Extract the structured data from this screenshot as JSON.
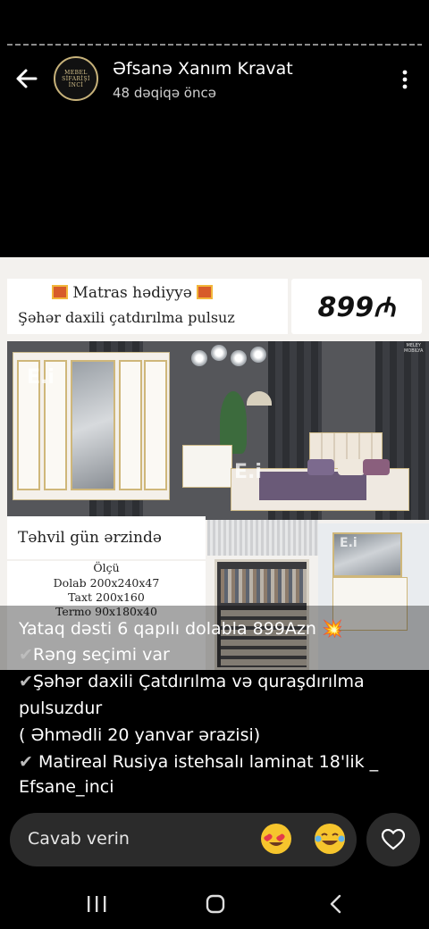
{
  "story": {
    "progress": 1.0
  },
  "header": {
    "title": "Əfsanə Xanım Kravat",
    "time": "48 dəqiqə öncə",
    "avatar_text": [
      "MEBEL",
      "SİFARİŞİ",
      "İNCİ"
    ]
  },
  "post_image": {
    "banner_line1": "Matras hədiyyə",
    "banner_line2": "Şəhər daxili çatdırılma pulsuz",
    "price": "899₼",
    "watermark": "E.i",
    "brand": [
      "MELEY",
      "MOBILYA"
    ],
    "delivery": "Təhvil gün ərzində",
    "specs": [
      "Ölçü",
      "Dolab 200x240x47",
      "Taxt 200x160",
      "Termo 90x180x40"
    ]
  },
  "caption": {
    "line1": "Yataq dəsti 6 qapılı dolabla 899Azn 💥",
    "line2": "Rəng seçimi var",
    "line3": "Şəhər daxili Çatdırılma və quraşdırılma",
    "line4": "pulsuzdur",
    "line5": "( Əhmədli 20 yanvar ərazisi)",
    "line6": " Matireal Rusiya istehsalı laminat 18'lik _",
    "line7": "Efsane_inci"
  },
  "reply": {
    "placeholder": "Cavab verin"
  },
  "icons": {
    "back": "arrow-left-icon",
    "menu": "more-vertical-icon",
    "heart": "heart-icon",
    "emoji1": "heart-eyes-emoji-icon",
    "emoji2": "tears-of-joy-emoji-icon",
    "nav": [
      "recent-apps-icon",
      "home-icon",
      "back-nav-icon"
    ]
  },
  "colors": {
    "background": "#000000",
    "reply_bar": "#2b2b2b",
    "gold": "#cfb77a"
  }
}
